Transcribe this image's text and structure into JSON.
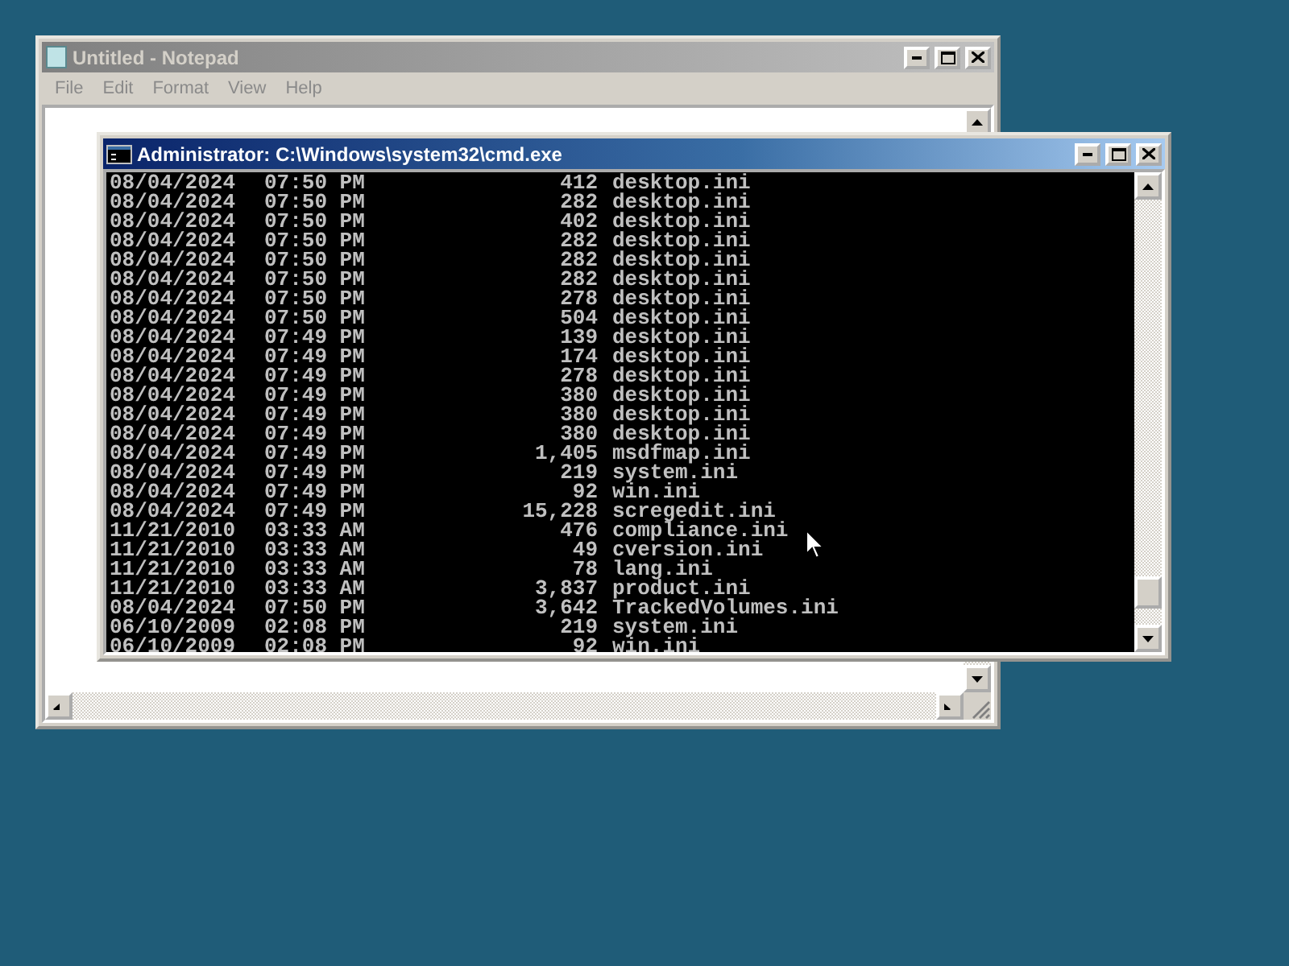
{
  "notepad": {
    "title": "Untitled - Notepad",
    "active": false,
    "menu": [
      "File",
      "Edit",
      "Format",
      "View",
      "Help"
    ]
  },
  "console": {
    "title": "Administrator: C:\\Windows\\system32\\cmd.exe",
    "active": true,
    "rows": [
      {
        "date": "08/04/2024",
        "time": "07:50 PM",
        "size": "412",
        "name": "desktop.ini"
      },
      {
        "date": "08/04/2024",
        "time": "07:50 PM",
        "size": "282",
        "name": "desktop.ini"
      },
      {
        "date": "08/04/2024",
        "time": "07:50 PM",
        "size": "402",
        "name": "desktop.ini"
      },
      {
        "date": "08/04/2024",
        "time": "07:50 PM",
        "size": "282",
        "name": "desktop.ini"
      },
      {
        "date": "08/04/2024",
        "time": "07:50 PM",
        "size": "282",
        "name": "desktop.ini"
      },
      {
        "date": "08/04/2024",
        "time": "07:50 PM",
        "size": "282",
        "name": "desktop.ini"
      },
      {
        "date": "08/04/2024",
        "time": "07:50 PM",
        "size": "278",
        "name": "desktop.ini"
      },
      {
        "date": "08/04/2024",
        "time": "07:50 PM",
        "size": "504",
        "name": "desktop.ini"
      },
      {
        "date": "08/04/2024",
        "time": "07:49 PM",
        "size": "139",
        "name": "desktop.ini"
      },
      {
        "date": "08/04/2024",
        "time": "07:49 PM",
        "size": "174",
        "name": "desktop.ini"
      },
      {
        "date": "08/04/2024",
        "time": "07:49 PM",
        "size": "278",
        "name": "desktop.ini"
      },
      {
        "date": "08/04/2024",
        "time": "07:49 PM",
        "size": "380",
        "name": "desktop.ini"
      },
      {
        "date": "08/04/2024",
        "time": "07:49 PM",
        "size": "380",
        "name": "desktop.ini"
      },
      {
        "date": "08/04/2024",
        "time": "07:49 PM",
        "size": "380",
        "name": "desktop.ini"
      },
      {
        "date": "08/04/2024",
        "time": "07:49 PM",
        "size": "1,405",
        "name": "msdfmap.ini"
      },
      {
        "date": "08/04/2024",
        "time": "07:49 PM",
        "size": "219",
        "name": "system.ini"
      },
      {
        "date": "08/04/2024",
        "time": "07:49 PM",
        "size": "92",
        "name": "win.ini"
      },
      {
        "date": "08/04/2024",
        "time": "07:49 PM",
        "size": "15,228",
        "name": "scregedit.ini"
      },
      {
        "date": "11/21/2010",
        "time": "03:33 AM",
        "size": "476",
        "name": "compliance.ini"
      },
      {
        "date": "11/21/2010",
        "time": "03:33 AM",
        "size": "49",
        "name": "cversion.ini"
      },
      {
        "date": "11/21/2010",
        "time": "03:33 AM",
        "size": "78",
        "name": "lang.ini"
      },
      {
        "date": "11/21/2010",
        "time": "03:33 AM",
        "size": "3,837",
        "name": "product.ini"
      },
      {
        "date": "08/04/2024",
        "time": "07:50 PM",
        "size": "3,642",
        "name": "TrackedVolumes.ini"
      },
      {
        "date": "06/10/2009",
        "time": "02:08 PM",
        "size": "219",
        "name": "system.ini"
      },
      {
        "date": "06/10/2009",
        "time": "02:08 PM",
        "size": "92",
        "name": "win.ini"
      }
    ]
  }
}
